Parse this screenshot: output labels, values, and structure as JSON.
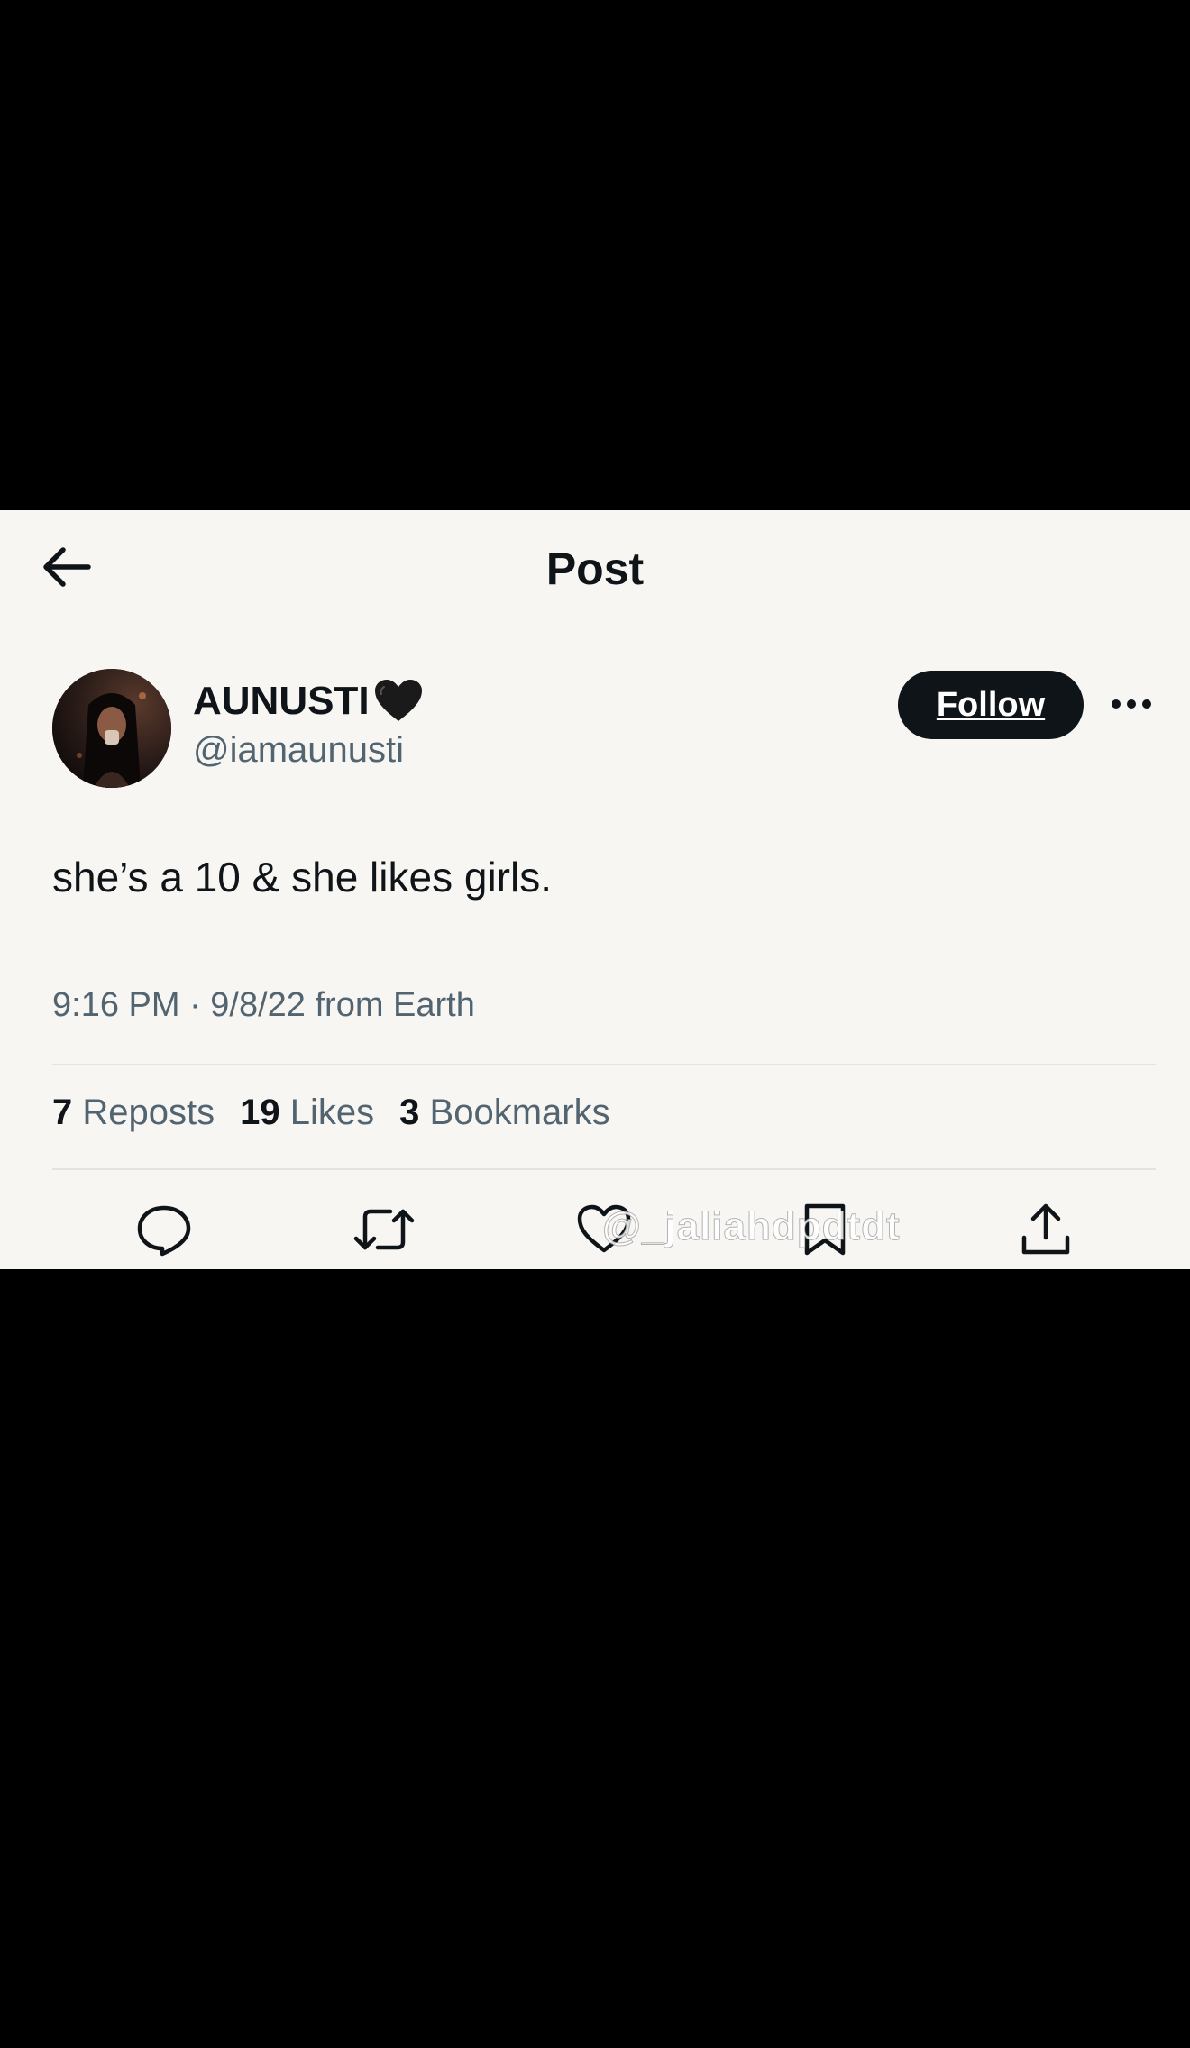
{
  "header": {
    "title": "Post",
    "back_icon": "arrow-left-icon"
  },
  "author": {
    "display_name": "AUNUSTI",
    "badge_emoji": "black-heart",
    "handle": "@iamaunusti",
    "avatar": "avatar-photo"
  },
  "follow_label": "Follow",
  "more_icon": "ellipsis-icon",
  "post": {
    "text": "she’s a 10 & she likes girls.",
    "timestamp": "9:16 PM · 9/8/22 from Earth"
  },
  "stats": {
    "reposts_count": "7",
    "reposts_label": "Reposts",
    "likes_count": "19",
    "likes_label": "Likes",
    "bookmarks_count": "3",
    "bookmarks_label": "Bookmarks"
  },
  "actions": [
    "reply-icon",
    "repost-icon",
    "like-icon",
    "bookmark-icon",
    "share-icon"
  ],
  "watermark": "@_jaliahdpdtdt",
  "colors": {
    "background": "#f7f6f3",
    "text_primary": "#0f1419",
    "text_secondary": "#536471",
    "follow_bg": "#0f1419",
    "letterbox": "#000000"
  }
}
